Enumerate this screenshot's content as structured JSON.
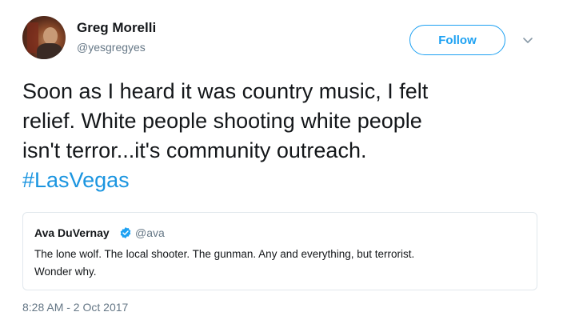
{
  "author": {
    "display_name": "Greg Morelli",
    "handle": "@yesgregyes"
  },
  "follow_button": {
    "label": "Follow"
  },
  "tweet": {
    "text_line1": "Soon as I heard it was country music, I felt",
    "text_line2": "relief. White people shooting white people",
    "text_line3": "isn't terror...it's community outreach.",
    "hashtag": "#LasVegas"
  },
  "quoted_tweet": {
    "display_name": "Ava DuVernay",
    "handle": "@ava",
    "text_line1": "The lone wolf. The local shooter. The gunman. Any and everything, but terrorist.",
    "text_line2": "Wonder why."
  },
  "timestamp": "8:28 AM - 2 Oct 2017",
  "icons": {
    "verified": "verified-badge-icon",
    "menu": "chevron-down-icon"
  },
  "colors": {
    "accent": "#1da1f2",
    "hashtag": "#1b95e0",
    "secondary_text": "#657786",
    "border": "#e1e8ed"
  }
}
